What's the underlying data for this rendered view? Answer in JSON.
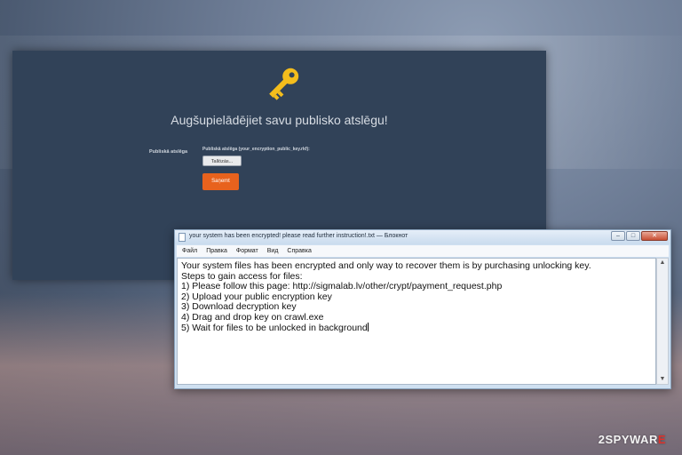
{
  "ransom_page": {
    "title": "Augšupielādējiet savu publisko atslēgu!",
    "field_label": "Publiskā atslēga",
    "field_hint": "Publiskā atslēga (your_encryption_public_key.rkf):",
    "browse_label": "Tallózás...",
    "submit_label": "Saņemt",
    "accent_color": "#e8621d",
    "key_icon": "key-icon"
  },
  "notepad": {
    "title": "your system has been encrypted! please read further instruction!.txt — Блокнот",
    "menu": [
      "Файл",
      "Правка",
      "Формат",
      "Вид",
      "Справка"
    ],
    "lines": [
      "Your system files has been encrypted and only way to recover them is by purchasing unlocking key.",
      "Steps to gain access for files:",
      "1) Please follow this page: http://sigmalab.lv/other/crypt/payment_request.php",
      "2) Upload your public encryption key",
      "3) Download decryption key",
      "4) Drag and drop key on crawl.exe",
      "5) Wait for files to be unlocked in background"
    ]
  },
  "watermark": {
    "prefix": "2",
    "middle": "SPYWAR",
    "suffix": "E"
  }
}
